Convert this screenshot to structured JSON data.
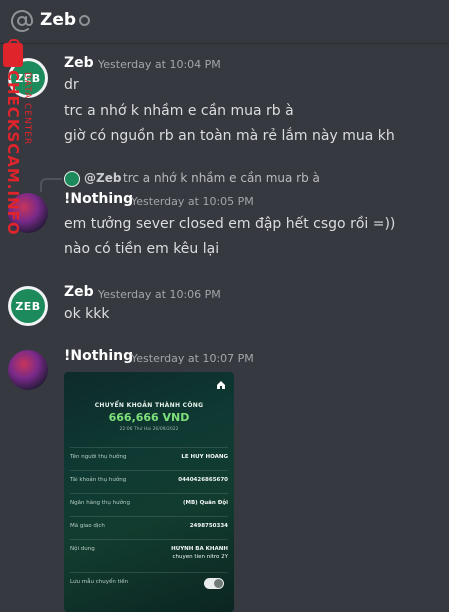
{
  "header": {
    "title": "Zeb",
    "icon": "at-sign-icon"
  },
  "watermark": {
    "main": "CHECKSCAM.INFO",
    "sub": "DATA CENTER"
  },
  "messages": [
    {
      "user": "Zeb",
      "time": "Yesterday at 10:04 PM",
      "avatar_text": "ZEB",
      "lines": [
        "dr",
        "trc a nhớ k nhầm e cần mua rb à",
        "giờ có nguồn rb an toàn mà rẻ lắm này mua kh"
      ]
    },
    {
      "user": "!Nothing",
      "time": "Yesterday at 10:05 PM",
      "reply": {
        "name": "@Zeb",
        "text": "trc a nhớ k nhầm e cần mua rb à"
      },
      "lines": [
        "em tưởng sever closed em đập hết csgo rồi =))",
        "nào có tiền em kêu lại"
      ]
    },
    {
      "user": "Zeb",
      "time": "Yesterday at 10:06 PM",
      "avatar_text": "ZEB",
      "lines": [
        "ok kkk"
      ]
    },
    {
      "user": "!Nothing",
      "time": "Yesterday at 10:07 PM",
      "attachment": {
        "title": "CHUYỂN KHOẢN THÀNH CÔNG",
        "amount": "666,666 VND",
        "datetime": "22:06 Thứ Hai 26/09/2022",
        "rows": [
          {
            "label": "Tên người thụ hưởng",
            "value": "LE HUY HOANG"
          },
          {
            "label": "Tài khoản thụ hưởng",
            "value": "0440426865670"
          },
          {
            "label": "Ngân hàng thụ hưởng",
            "value": "(MB) Quân Đội"
          },
          {
            "label": "Mã giao dịch",
            "value": "2498750334"
          },
          {
            "label": "Nội dung",
            "value": "HUYNH BA KHANH",
            "value2": "chuyen tien nitro 2Y"
          },
          {
            "label": "Lưu mẫu chuyển tiền",
            "value": ""
          }
        ],
        "colors": {
          "amount": "#7ee07a",
          "background": "#0f3a33"
        }
      }
    }
  ]
}
